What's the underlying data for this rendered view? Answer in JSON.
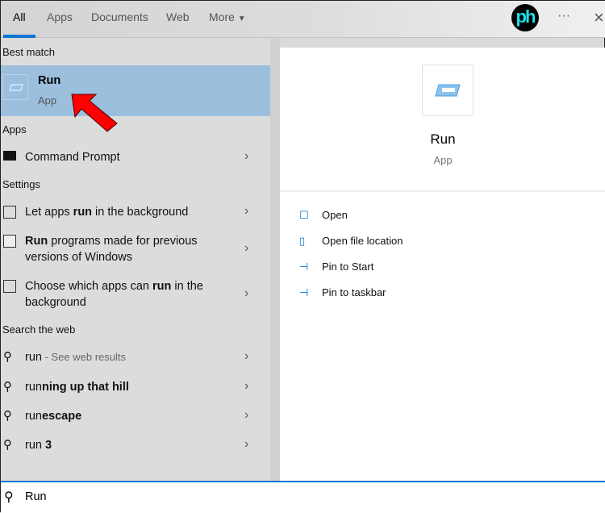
{
  "tabs": [
    {
      "label": "All"
    },
    {
      "label": "Apps"
    },
    {
      "label": "Documents"
    },
    {
      "label": "Web"
    },
    {
      "label": "More"
    }
  ],
  "avatar": "ph",
  "sections": {
    "best_match": "Best match",
    "apps": "Apps",
    "settings": "Settings",
    "web": "Search the web"
  },
  "best": {
    "title": "Run",
    "subtitle": "App"
  },
  "apps": [
    {
      "label": "Command Prompt"
    }
  ],
  "settings": [
    {
      "pre": "Let apps ",
      "bold": "run",
      "post": " in the background"
    },
    {
      "pre": "",
      "bold": "Run",
      "post": " programs made for previous versions of Windows"
    },
    {
      "pre": "Choose which apps can ",
      "bold": "run",
      "post": " in the background"
    }
  ],
  "web": [
    {
      "normal": "run",
      "bold": "",
      "hint": " - See web results"
    },
    {
      "normal": "run",
      "bold": "ning up that hill",
      "hint": ""
    },
    {
      "normal": "run",
      "bold": "escape",
      "hint": ""
    },
    {
      "normal": "run ",
      "bold": "3",
      "hint": ""
    }
  ],
  "detail": {
    "title": "Run",
    "subtitle": "App",
    "actions": [
      {
        "label": "Open"
      },
      {
        "label": "Open file location"
      },
      {
        "label": "Pin to Start"
      },
      {
        "label": "Pin to taskbar"
      }
    ]
  },
  "search": {
    "value": "Run"
  },
  "colors": {
    "accent": "#0a74d1",
    "highlight": "#9bbfdc",
    "annotation_arrow": "#ff0000"
  }
}
